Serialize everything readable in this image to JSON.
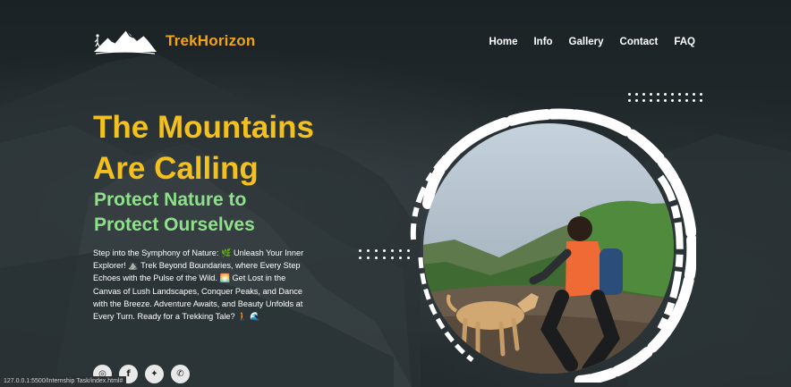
{
  "brand": {
    "name": "TrekHorizon",
    "logo_icon": "mountain-hiker-icon",
    "accent": "#f0a41c"
  },
  "nav": {
    "items": [
      "Home",
      "Info",
      "Gallery",
      "Contact",
      "FAQ"
    ]
  },
  "hero": {
    "headline_line1": "The Mountains",
    "headline_line2": "Are Calling",
    "subhead_line1": "Protect Nature to",
    "subhead_line2": "Protect Ourselves",
    "headline_color": "#f2c11f",
    "subhead_color": "#8ee08a",
    "description": "Step into the Symphony of Nature: 🌿 Unleash Your Inner Explorer! ⛰️ Trek Beyond Boundaries, where Every Step Echoes with the Pulse of the Wild. 🌅 Get Lost in the Canvas of Lush Landscapes, Conquer Peaks, and Dance with the Breeze. Adventure Awaits, and Beauty Unfolds at Every Turn. Ready for a Trekking Tale? 🚶 🌊"
  },
  "socials": [
    {
      "name": "instagram-icon",
      "glyph": "◎"
    },
    {
      "name": "facebook-icon",
      "glyph": "f"
    },
    {
      "name": "twitter-icon",
      "glyph": "✦"
    },
    {
      "name": "whatsapp-icon",
      "glyph": "✆"
    }
  ],
  "photo": {
    "subject": "trekker-with-dog"
  },
  "status_bar": {
    "url": "127.0.0.1:5500/Internship Task/index.html#"
  }
}
